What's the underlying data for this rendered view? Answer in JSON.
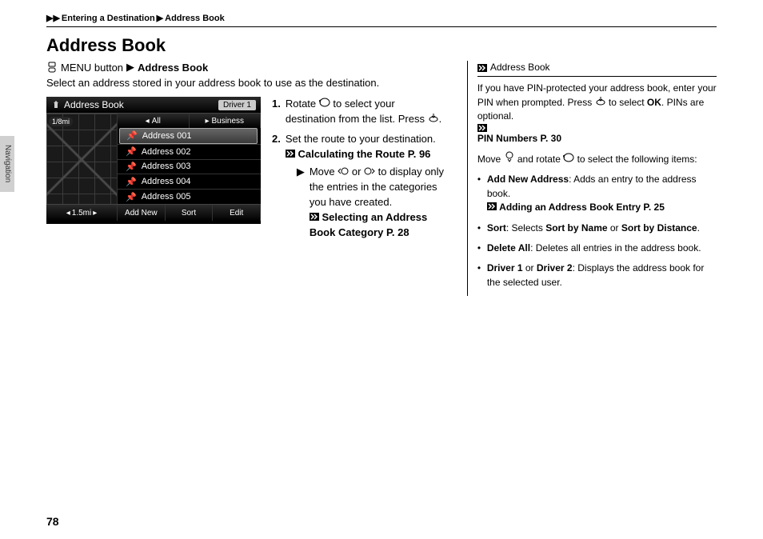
{
  "breadcrumb": {
    "part1": "Entering a Destination",
    "part2": "Address Book"
  },
  "section_title": "Address Book",
  "side_tab": "Navigation",
  "page_number": "78",
  "instruction": {
    "menu_button": "MENU button",
    "target": "Address Book"
  },
  "lead": "Select an address stored in your address book to use as the destination.",
  "screenshot": {
    "title": "Address Book",
    "driver": "Driver 1",
    "zoom": "1/8mi",
    "categories": [
      "All",
      "Business"
    ],
    "items": [
      "Address 001",
      "Address 002",
      "Address 003",
      "Address 004",
      "Address 005"
    ],
    "scale": "1.5mi",
    "footer": [
      "Add New",
      "Sort",
      "Edit"
    ]
  },
  "steps": [
    {
      "num": "1.",
      "text_a": "Rotate ",
      "text_b": " to select your destination from the list. Press ",
      "text_c": "."
    },
    {
      "num": "2.",
      "text_a": "Set the route to your destination.",
      "ref": "Calculating the Route",
      "ref_page": "P. 96",
      "sub_a": "Move ",
      "sub_b": " or ",
      "sub_c": " to display only the entries in the categories you have created.",
      "sub_ref": "Selecting an Address Book Category",
      "sub_ref_page": "P. 28"
    }
  ],
  "sidebar": {
    "heading": "Address Book",
    "p1_a": "If you have PIN-protected your address book, enter your PIN when prompted. Press ",
    "p1_b": " to select ",
    "p1_ok": "OK",
    "p1_c": ". PINs are optional.",
    "ref1": "PIN Numbers",
    "ref1_page": "P. 30",
    "p2_a": "Move ",
    "p2_b": " and rotate ",
    "p2_c": " to select the following items:",
    "bullets": [
      {
        "term": "Add New Address",
        "desc": ": Adds an entry to the address book.",
        "ref": "Adding an Address Book Entry",
        "ref_page": "P. 25"
      },
      {
        "term": "Sort",
        "desc": ": Selects ",
        "opt1": "Sort by Name",
        "mid": " or ",
        "opt2": "Sort by Distance",
        "tail": "."
      },
      {
        "term": "Delete All",
        "desc": ": Deletes all entries in the address book."
      },
      {
        "term_a": "Driver 1",
        "mid": " or ",
        "term_b": "Driver 2",
        "desc": ": Displays the address book for the selected user."
      }
    ]
  }
}
